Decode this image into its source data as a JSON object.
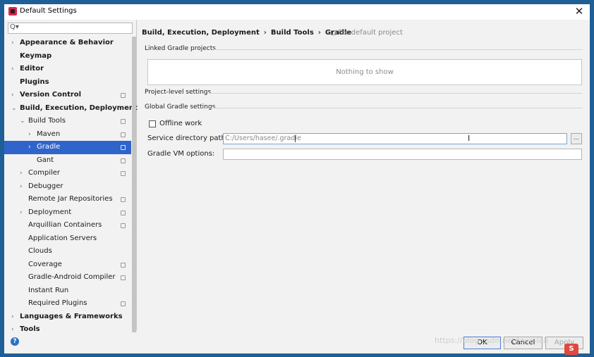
{
  "window": {
    "title": "Default Settings",
    "close_glyph": "✕"
  },
  "search": {
    "icon": "Q▾",
    "value": ""
  },
  "sidebar": {
    "items": [
      {
        "label": "Appearance & Behavior",
        "arrow": "›",
        "level": 0,
        "bold": true
      },
      {
        "label": "Keymap",
        "arrow": "",
        "level": 0,
        "bold": true
      },
      {
        "label": "Editor",
        "arrow": "›",
        "level": 0,
        "bold": true
      },
      {
        "label": "Plugins",
        "arrow": "",
        "level": 0,
        "bold": true
      },
      {
        "label": "Version Control",
        "arrow": "›",
        "level": 0,
        "bold": true,
        "copy": true
      },
      {
        "label": "Build, Execution, Deployment",
        "arrow": "⌄",
        "level": 0,
        "bold": true
      },
      {
        "label": "Build Tools",
        "arrow": "⌄",
        "level": 1,
        "copy": true
      },
      {
        "label": "Maven",
        "arrow": "›",
        "level": 2,
        "copy": true
      },
      {
        "label": "Gradle",
        "arrow": "›",
        "level": 2,
        "copy": true,
        "selected": true
      },
      {
        "label": "Gant",
        "arrow": "",
        "level": 2,
        "copy": true
      },
      {
        "label": "Compiler",
        "arrow": "›",
        "level": 1,
        "copy": true
      },
      {
        "label": "Debugger",
        "arrow": "›",
        "level": 1
      },
      {
        "label": "Remote Jar Repositories",
        "arrow": "",
        "level": 1,
        "copy": true
      },
      {
        "label": "Deployment",
        "arrow": "›",
        "level": 1,
        "copy": true
      },
      {
        "label": "Arquillian Containers",
        "arrow": "",
        "level": 1,
        "copy": true
      },
      {
        "label": "Application Servers",
        "arrow": "",
        "level": 1
      },
      {
        "label": "Clouds",
        "arrow": "",
        "level": 1
      },
      {
        "label": "Coverage",
        "arrow": "",
        "level": 1,
        "copy": true
      },
      {
        "label": "Gradle-Android Compiler",
        "arrow": "",
        "level": 1,
        "copy": true
      },
      {
        "label": "Instant Run",
        "arrow": "",
        "level": 1
      },
      {
        "label": "Required Plugins",
        "arrow": "",
        "level": 1,
        "copy": true
      },
      {
        "label": "Languages & Frameworks",
        "arrow": "›",
        "level": 0,
        "bold": true
      },
      {
        "label": "Tools",
        "arrow": "›",
        "level": 0,
        "bold": true
      }
    ]
  },
  "breadcrumb": {
    "items": [
      "Build, Execution, Deployment",
      "Build Tools",
      "Gradle"
    ],
    "separator": "›",
    "for_default": "For default project"
  },
  "sections": {
    "linked": "Linked Gradle projects",
    "linked_empty": "Nothing to show",
    "project_level": "Project-level settings",
    "global": "Global Gradle settings"
  },
  "global_settings": {
    "offline_label": "Offline work",
    "offline_checked": false,
    "service_dir_label": "Service directory path:",
    "service_dir_value": "C:/Users/hasee/.gradle",
    "browse_label": "...",
    "vm_options_label": "Gradle VM options:",
    "vm_options_value": ""
  },
  "footer": {
    "help": "?",
    "ok": "OK",
    "cancel": "Cancel",
    "apply": "Apply",
    "watermark": "https://blog.csdn.net/java-lab",
    "watermark_logo": "S"
  },
  "colors": {
    "selection": "#2f65ca",
    "desktop": "#1f5f96"
  }
}
